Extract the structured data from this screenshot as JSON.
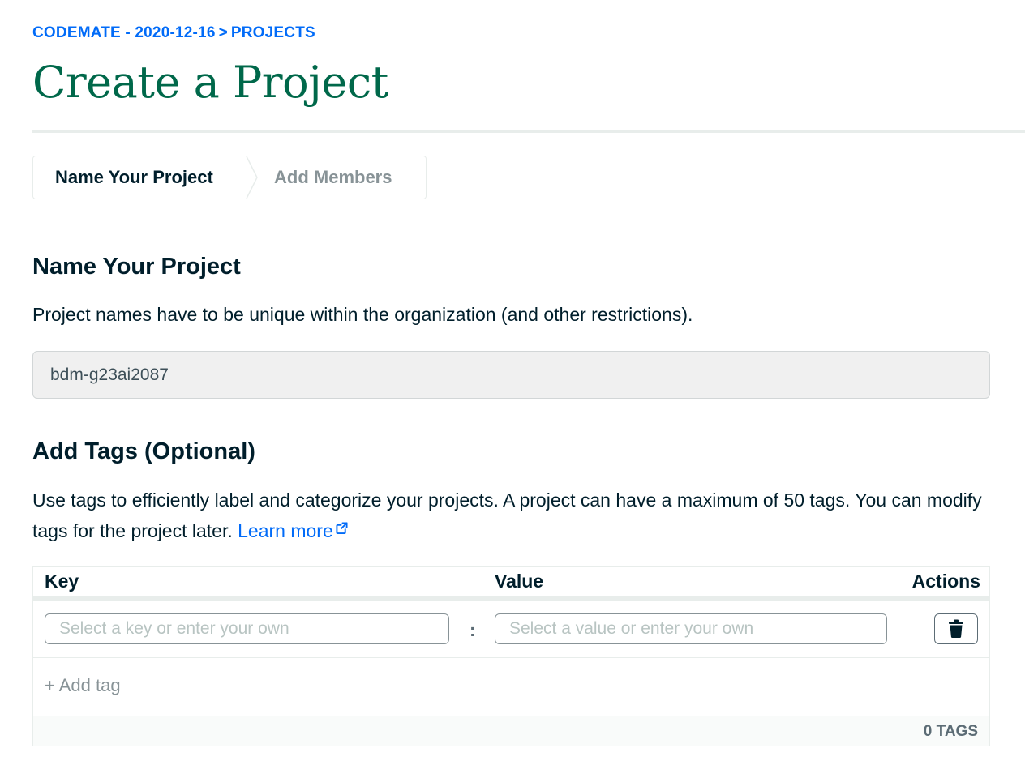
{
  "breadcrumb": {
    "org": "CODEMATE - 2020-12-16",
    "separator": ">",
    "current": "PROJECTS"
  },
  "page_title": "Create a Project",
  "stepper": {
    "steps": [
      {
        "label": "Name Your Project",
        "active": true
      },
      {
        "label": "Add Members",
        "active": false
      }
    ]
  },
  "name_section": {
    "heading": "Name Your Project",
    "description": "Project names have to be unique within the organization (and other restrictions).",
    "input_value": "bdm-g23ai2087"
  },
  "tags_section": {
    "heading": "Add Tags (Optional)",
    "description": "Use tags to efficiently label and categorize your projects. A project can have a maximum of 50 tags. You can modify tags for the project later.",
    "learn_more": "Learn more",
    "columns": {
      "key": "Key",
      "value": "Value",
      "actions": "Actions"
    },
    "key_placeholder": "Select a key or enter your own",
    "separator": ":",
    "value_placeholder": "Select a value or enter your own",
    "add_tag": "+ Add tag",
    "tag_count": "0 TAGS"
  },
  "icons": {
    "external_link": "external-link-icon",
    "trash": "trash-icon"
  },
  "colors": {
    "link": "#016bf8",
    "title_green": "#00684a",
    "text_dark": "#001e2b",
    "text_muted": "#889397"
  }
}
